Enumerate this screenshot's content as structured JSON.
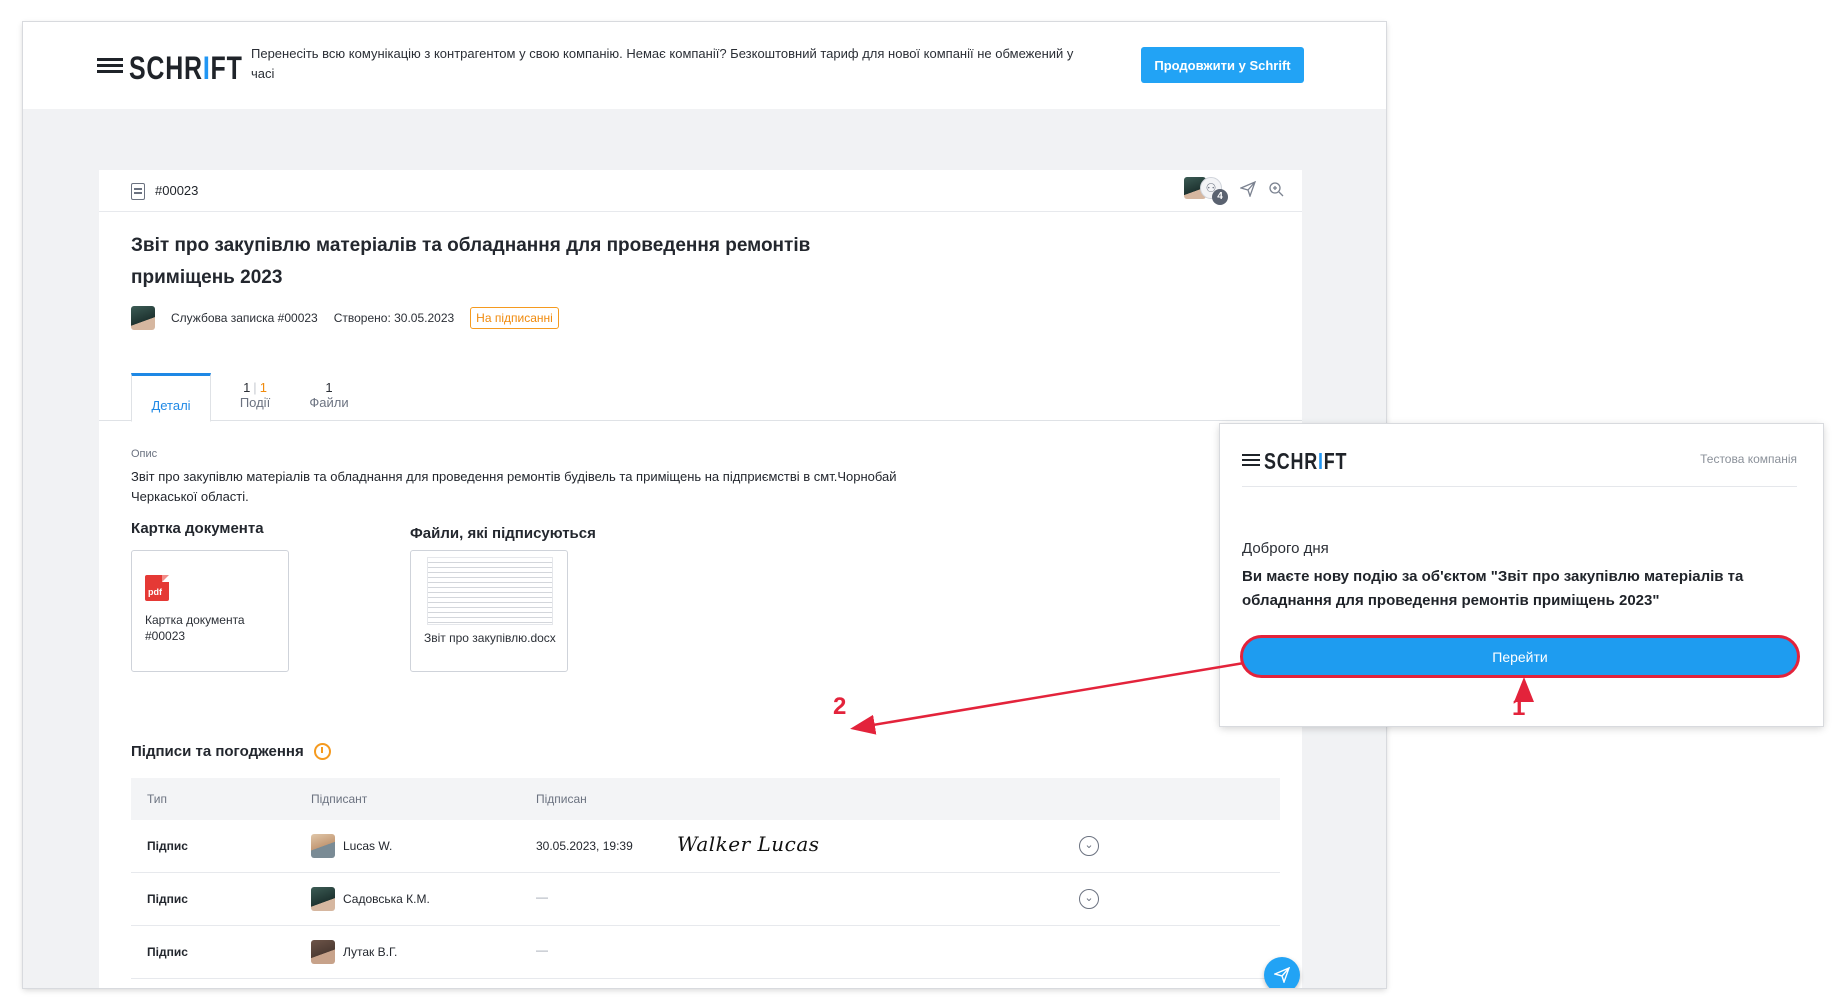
{
  "topbar": {
    "logo_text": "SCHRIFT",
    "promo_text": "Перенесіть всю комунікацію з контрагентом у свою компанію. Немає компанії? Безкоштовний тариф для нової компанії не обмежений у часі",
    "cta_label": "Продовжити у Schrift"
  },
  "document": {
    "number": "#00023",
    "participants_count": "4",
    "title": "Звіт про закупівлю матеріалів та обладнання для проведення ремонтів приміщень 2023",
    "type_label": "Службова записка",
    "type_number": "#00023",
    "created_label": "Створено: 30.05.2023",
    "status": "На підписанні",
    "tabs": {
      "details": "Деталі",
      "events_count_a": "1",
      "events_count_b": "1",
      "events_label": "Події",
      "files_count": "1",
      "files_label": "Файли"
    },
    "description_label": "Опис",
    "description": "Звіт про закупівлю матеріалів та обладнання для проведення ремонтів будівель та приміщень на підприємстві в смт.Чорнобай Черкаської області.",
    "card_heading": "Картка документа",
    "card_file": "Картка документа #00023",
    "pdf_badge": "pdf",
    "files_heading": "Файли, які підписуються",
    "signed_file": "Звіт про закупівлю.docx",
    "signatures_heading": "Підписи та погодження",
    "table": {
      "headers": [
        "Тип",
        "Підписант",
        "Підписан"
      ],
      "rows": [
        {
          "type": "Підпис",
          "signer": "Lucas W.",
          "date": "30.05.2023, 19:39",
          "signature": "Walker Lucas"
        },
        {
          "type": "Підпис",
          "signer": "Садовська К.М.",
          "date": "—"
        },
        {
          "type": "Підпис",
          "signer": "Лутак В.Г.",
          "date": "—"
        }
      ]
    }
  },
  "popup": {
    "logo_text": "SCHRIFT",
    "company": "Тестова компанія",
    "greeting": "Доброго дня",
    "message": "Ви маєте нову подію за об'єктом \"Звіт про закупівлю матеріалів та обладнання для проведення ремонтів приміщень 2023\"",
    "button_label": "Перейти"
  },
  "annotations": {
    "step_1": "1",
    "step_2": "2",
    "color": "#e3233b"
  },
  "colors": {
    "accent": "#22a3f5",
    "status": "#f08a0c",
    "tab_active": "#1e88e5"
  }
}
